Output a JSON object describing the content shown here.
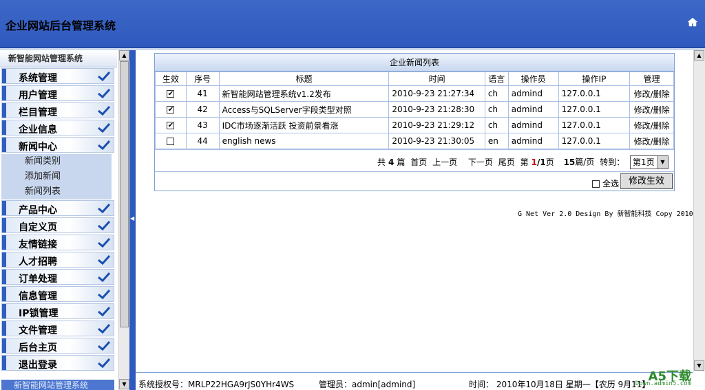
{
  "header": {
    "title": "企业网站后台管理系统",
    "home_icon": "home-icon"
  },
  "sidebar": {
    "title": "新智能网站管理系统",
    "items": [
      {
        "label": "系统管理"
      },
      {
        "label": "用户管理"
      },
      {
        "label": "栏目管理"
      },
      {
        "label": "企业信息"
      },
      {
        "label": "新闻中心"
      }
    ],
    "news_sub": [
      {
        "label": "新闻类别"
      },
      {
        "label": "添加新闻"
      },
      {
        "label": "新闻列表"
      }
    ],
    "items2": [
      {
        "label": "产品中心"
      },
      {
        "label": "自定义页"
      },
      {
        "label": "友情链接"
      },
      {
        "label": "人才招聘"
      },
      {
        "label": "订单处理"
      },
      {
        "label": "信息管理"
      },
      {
        "label": "IP锁管理"
      },
      {
        "label": "文件管理"
      },
      {
        "label": "后台主页"
      },
      {
        "label": "退出登录"
      }
    ],
    "bottom_label": "新智能网站管理系统"
  },
  "news_panel": {
    "title": "企业新闻列表",
    "columns": [
      "生效",
      "序号",
      "标题",
      "时间",
      "语言",
      "操作员",
      "操作IP",
      "管理"
    ],
    "rows": [
      {
        "active": true,
        "id": "41",
        "title": "新智能网站管理系统v1.2发布",
        "time": "2010-9-23 21:27:34",
        "lang": "ch",
        "operator": "admind",
        "ip": "127.0.0.1",
        "manage": "修改/删除"
      },
      {
        "active": true,
        "id": "42",
        "title": "Access与SQLServer字段类型对照",
        "time": "2010-9-23 21:28:30",
        "lang": "ch",
        "operator": "admind",
        "ip": "127.0.0.1",
        "manage": "修改/删除"
      },
      {
        "active": true,
        "id": "43",
        "title": "IDC市场逐渐活跃 投资前景看涨",
        "time": "2010-9-23 21:29:12",
        "lang": "ch",
        "operator": "admind",
        "ip": "127.0.0.1",
        "manage": "修改/删除"
      },
      {
        "active": false,
        "id": "44",
        "title": "english news",
        "time": "2010-9-23 21:30:05",
        "lang": "en",
        "operator": "admind",
        "ip": "127.0.0.1",
        "manage": "修改/删除"
      }
    ],
    "pager": {
      "total_prefix": "共",
      "total": "4",
      "total_suffix": "篇",
      "first": "首页",
      "prev": "上一页",
      "next": "下一页",
      "last": "尾页",
      "page_prefix": "第",
      "current": "1",
      "sep": "/",
      "pages": "1",
      "page_suffix": "页",
      "per_page": "15",
      "per_page_suffix": "篇/页",
      "goto": "转到：",
      "select_value": "第1页"
    },
    "select_all": "全选",
    "submit": "修改生效"
  },
  "copyright": "G Net Ver 2.0 Design By 新智能科技 Copy 2010",
  "status": {
    "license": "系统授权号：MRLP22HGA9rJS0YHr4WS",
    "admin": "管理员：admin[admind]",
    "time": "时间： 2010年10月18日 星期一【农历 9月11】"
  },
  "watermark": {
    "main": "A5下载",
    "sub": "Down.admin5.com"
  }
}
